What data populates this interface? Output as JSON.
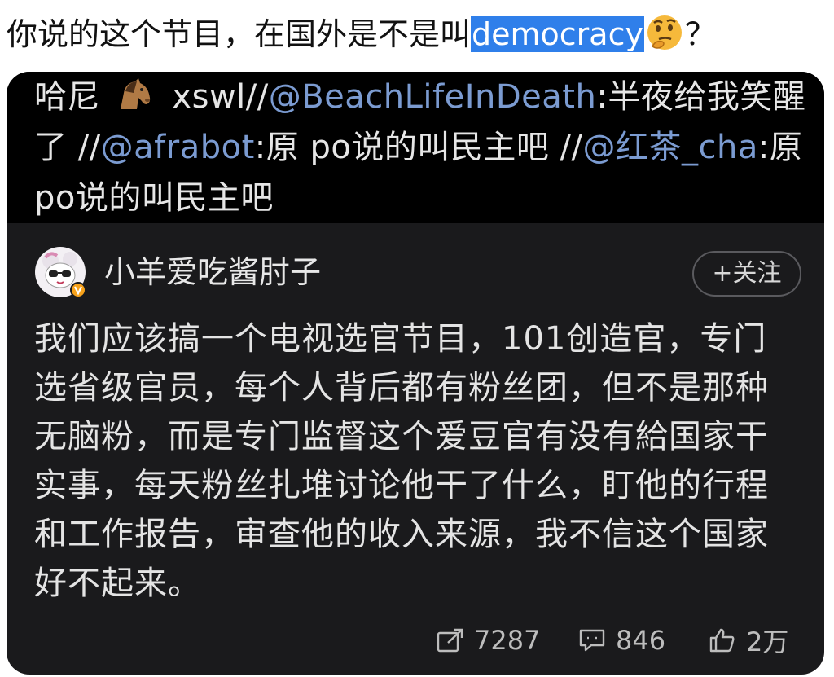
{
  "tweet": {
    "text_before": "你说的这个节目，在国外是不是叫",
    "highlight": "democracy",
    "emoji_icon": "thinking-face-icon",
    "text_after": "？",
    "highlight_color": "#2f7fea"
  },
  "repost": {
    "prefix": "哈尼",
    "horse_icon": "horse-emoji-icon",
    "part1": " xswl//",
    "mention1": "@BeachLifeInDeath",
    "part2": ":半夜给我笑醒了 //",
    "mention2": "@afrabot",
    "part3": ":原 po说的叫民主吧 //",
    "mention3": "@红茶_cha",
    "part4": ":原 po说的叫民主吧",
    "mention_color": "#7b9bd1"
  },
  "post": {
    "author": "小羊爱吃酱肘子",
    "follow_label": "+关注",
    "body": "我们应该搞一个电视选官节目，101创造官，专门选省级官员，每个人背后都有粉丝团，但不是那种无脑粉，而是专门监督这个爱豆官有没有給国家干实事，每天粉丝扎堆讨论他干了什么，盯他的行程和工作报告，审查他的收入来源，我不信这个国家好不起来。",
    "stats": {
      "reposts": "7287",
      "comments": "846",
      "likes": "2万"
    }
  }
}
